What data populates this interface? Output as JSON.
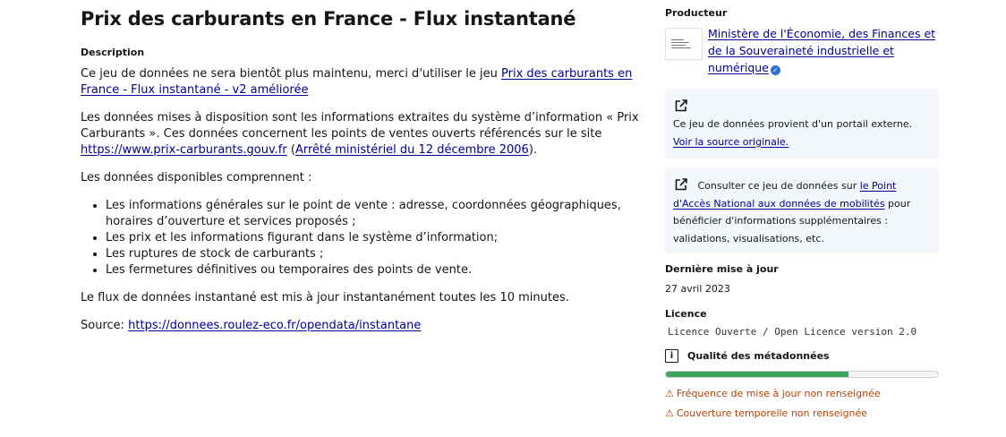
{
  "main": {
    "title": "Prix des carburants en France - Flux instantané",
    "description_label": "Description",
    "para1_text": "Ce jeu de données ne sera bientôt plus maintenu, merci d'utiliser le jeu ",
    "para1_link": "Prix des carburants en France - Flux instantané - v2 améliorée",
    "para2_text": "Les données mises à disposition sont les informations extraites du système d’information « Prix Carburants ». Ces données concernent les points de ventes ouverts référencés sur le site ",
    "para2_link1": "https://www.prix-carburants.gouv.fr",
    "para2_open": " (",
    "para2_link2": "Arrêté ministériel du 12 décembre 2006",
    "para2_close": ").",
    "para3": "Les données disponibles comprennent :",
    "list": [
      "Les informations générales sur le point de vente : adresse, coordonnées géographiques, horaires d’ouverture et services proposés ;",
      "Les prix et les informations figurant dans le système d’information;",
      "Les ruptures de stock de carburants ;",
      "Les fermetures définitives ou temporaires des points de vente."
    ],
    "para4": "Le flux de données instantané est mis à jour instantanément toutes les 10 minutes.",
    "source_label": "Source: ",
    "source_link": "https://donnees.roulez-eco.fr/opendata/instantane"
  },
  "sidebar": {
    "producer_label": "Producteur",
    "producer_name": "Ministère de l'Économie, des Finances et de la Souveraineté industrielle et numérique",
    "external_box": {
      "text": "Ce jeu de données provient d'un portail externe.",
      "link": "Voir la source originale."
    },
    "pan_box": {
      "text_before": "Consulter ce jeu de données sur ",
      "link": "le Point d'Accès National aux données de mobilités",
      "text_after": " pour bénéficier d'informations supplémentaires : validations, visualisations, etc."
    },
    "last_update_label": "Dernière mise à jour",
    "last_update_value": "27 avril 2023",
    "license_label": "Licence",
    "license_value": "Licence Ouverte / Open Licence version 2.0",
    "quality_label": "Qualité des métadonnées",
    "quality_fraction": 0.67,
    "warnings": [
      "Fréquence de mise à jour non renseignée",
      "Couverture temporelle non renseignée"
    ],
    "colors": {
      "link": "#000091",
      "box_bg": "#f3f6fb",
      "quality_bar": "#3fa45b",
      "warning": "#b34000"
    },
    "icons": [
      "external-link-icon",
      "info-icon",
      "warning-icon",
      "verified-badge-icon"
    ]
  }
}
